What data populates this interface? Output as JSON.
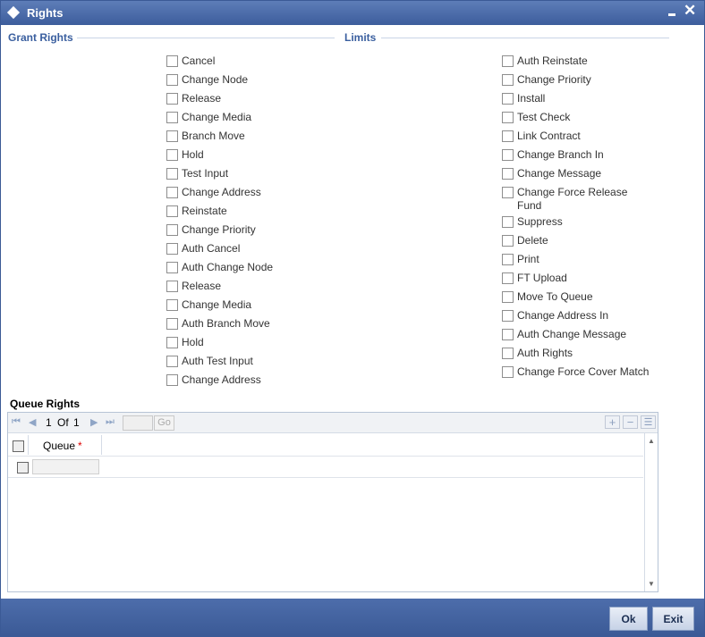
{
  "window": {
    "title": "Rights"
  },
  "sections": {
    "grant_rights": "Grant Rights",
    "limits": "Limits"
  },
  "grant_rights_items": [
    "Cancel",
    "Change Node",
    "Release",
    "Change Media",
    "Branch Move",
    "Hold",
    "Test Input",
    "Change Address",
    "Reinstate",
    "Change Priority",
    "Auth Cancel",
    "Auth Change Node",
    "Release",
    "Change Media",
    "Auth Branch Move",
    "Hold",
    "Auth Test Input",
    "Change Address"
  ],
  "limits_items": [
    "Auth Reinstate",
    "Change Priority",
    "Install",
    "Test Check",
    "Link Contract",
    "Change Branch In",
    "Change Message",
    "Change Force Release Fund",
    "Suppress",
    "Delete",
    "Print",
    "FT Upload",
    "Move To Queue",
    "Change Address In",
    "Auth Change Message",
    "Auth Rights",
    "Change Force Cover Match"
  ],
  "queue_rights": {
    "title": "Queue Rights",
    "pagination": {
      "current": "1",
      "of_label": "Of",
      "total": "1",
      "go_label": "Go"
    },
    "column": "Queue",
    "required_mark": "*"
  },
  "buttons": {
    "ok": "Ok",
    "exit": "Exit"
  },
  "colors": {
    "titlebar": "#3d5d9c",
    "section_head": "#3a5f9f",
    "footer": "#3b5a96"
  }
}
